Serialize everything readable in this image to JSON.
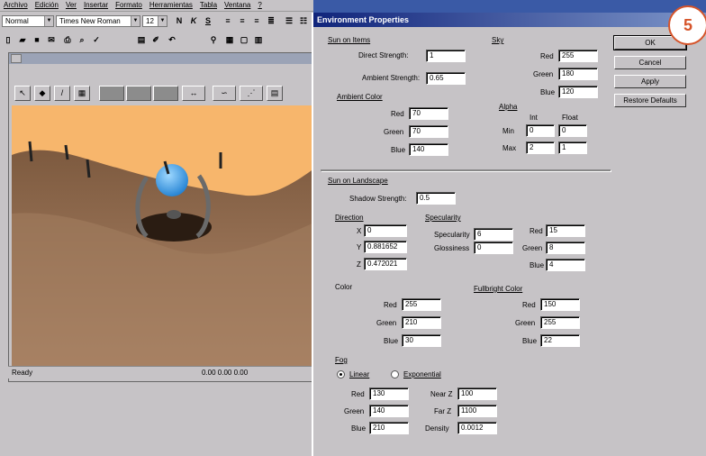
{
  "word": {
    "menu": [
      "Archivo",
      "Edición",
      "Ver",
      "Insertar",
      "Formato",
      "Herramientas",
      "Tabla",
      "Ventana",
      "?"
    ],
    "style_combo": "Normal",
    "font_combo": "Times New Roman",
    "size_combo": "12",
    "bold": "N",
    "italic": "K",
    "underline": "S"
  },
  "editor": {
    "status_left": "Ready",
    "status_right": "0.00 0.00 0.00",
    "sky_color": "#f7b66c"
  },
  "dialog": {
    "title": "Environment Properties",
    "sun_items": {
      "heading": "Sun on Items",
      "direct_label": "Direct Strength:",
      "direct_value": "1",
      "ambient_label": "Ambient Strength:",
      "ambient_value": "0.65",
      "ambient_color_heading": "Ambient Color",
      "red_label": "Red",
      "red_value": "70",
      "green_label": "Green",
      "green_value": "70",
      "blue_label": "Blue",
      "blue_value": "140"
    },
    "sky": {
      "heading": "Sky",
      "red_label": "Red",
      "red_value": "255",
      "green_label": "Green",
      "green_value": "180",
      "blue_label": "Blue",
      "blue_value": "120",
      "alpha_heading": "Alpha",
      "int_label": "Int",
      "float_label": "Float",
      "min_label": "Min",
      "max_label": "Max",
      "min_int": "0",
      "min_float": "0",
      "max_int": "2",
      "max_float": "1"
    },
    "sun_landscape": {
      "heading": "Sun on Landscape",
      "shadow_label": "Shadow Strength:",
      "shadow_value": "0.5",
      "direction_heading": "Direction",
      "x_label": "X",
      "x_value": "0",
      "y_label": "Y",
      "y_value": "0.881652",
      "z_label": "Z",
      "z_value": "0.472021",
      "specularity_heading": "Specularity",
      "spec_label": "Specularity",
      "spec_value": "6",
      "gloss_label": "Glossiness",
      "gloss_value": "0",
      "spec_red_label": "Red",
      "spec_red_value": "15",
      "spec_green_label": "Green",
      "spec_green_value": "8",
      "spec_blue_label": "Blue",
      "spec_blue_value": "4",
      "color_heading": "Color",
      "col_red_label": "Red",
      "col_red_value": "255",
      "col_green_label": "Green",
      "col_green_value": "210",
      "col_blue_label": "Blue",
      "col_blue_value": "30",
      "fb_heading": "Fullbright Color",
      "fb_red_label": "Red",
      "fb_red_value": "150",
      "fb_green_label": "Green",
      "fb_green_value": "255",
      "fb_blue_label": "Blue",
      "fb_blue_value": "22"
    },
    "fog": {
      "heading": "Fog",
      "linear_label": "Linear",
      "exponential_label": "Exponential",
      "red_label": "Red",
      "red_value": "130",
      "green_label": "Green",
      "green_value": "140",
      "blue_label": "Blue",
      "blue_value": "210",
      "nearz_label": "Near Z",
      "nearz_value": "100",
      "farz_label": "Far Z",
      "farz_value": "1100",
      "density_label": "Density",
      "density_value": "0.0012"
    },
    "buttons": {
      "ok": "OK",
      "cancel": "Cancel",
      "apply": "Apply",
      "restore": "Restore Defaults"
    }
  },
  "badge": "5"
}
